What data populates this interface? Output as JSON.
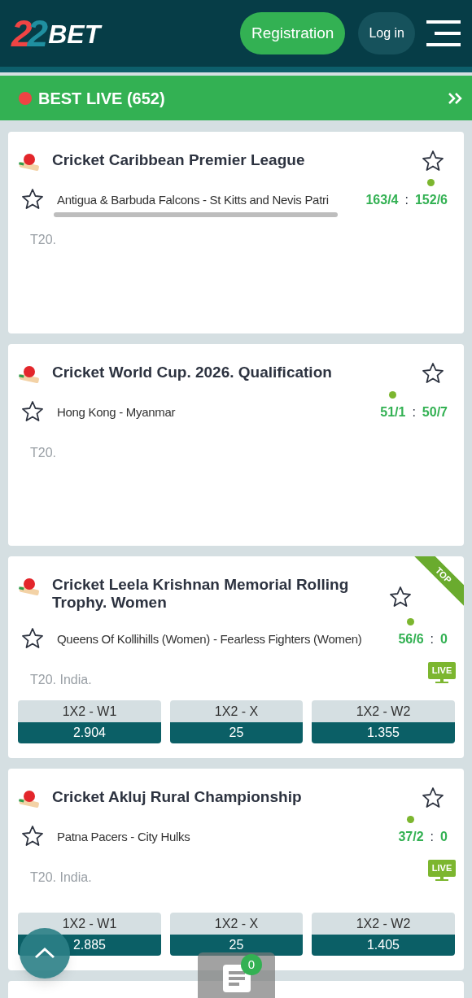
{
  "header": {
    "logo": {
      "digits": "22",
      "word": "BET"
    },
    "register_button": "Registration",
    "login_button": "Log in"
  },
  "live_bar": {
    "title": "BEST LIVE (652)"
  },
  "events": [
    {
      "league": "Cricket Caribbean Premier League",
      "teams": "Antigua & Barbuda Falcons - St Kitts and Nevis Patri",
      "scores": [
        {
          "value": "163/4",
          "batting": false
        },
        {
          "value": "152/6",
          "batting": true
        }
      ],
      "separator": ":",
      "info": "T20.",
      "live": false,
      "top": false,
      "scrolled": true
    },
    {
      "league": "Cricket World Cup. 2026. Qualification",
      "teams": "Hong Kong - Myanmar",
      "scores": [
        {
          "value": "51/1",
          "batting": true
        },
        {
          "value": "50/7",
          "batting": false
        }
      ],
      "separator": ":",
      "info": "T20.",
      "live": false,
      "top": false,
      "scrolled": false
    },
    {
      "league": "Cricket Leela Krishnan Memorial Rolling Trophy. Women",
      "teams": "Queens Of Kollihills (Women) - Fearless Fighters (Women)",
      "scores": [
        {
          "value": "56/6",
          "batting": true
        },
        {
          "value": "0",
          "batting": false
        }
      ],
      "separator": ":",
      "info": "T20. India.",
      "live": true,
      "live_label": "LIVE",
      "top": true,
      "top_label": "TOP",
      "scrolled": false,
      "odds": [
        {
          "label": "1X2 - W1",
          "value": "2.904"
        },
        {
          "label": "1X2 - X",
          "value": "25"
        },
        {
          "label": "1X2 - W2",
          "value": "1.355"
        }
      ]
    },
    {
      "league": "Cricket Akluj Rural Championship",
      "teams": "Patna Pacers - City Hulks",
      "scores": [
        {
          "value": "37/2",
          "batting": true
        },
        {
          "value": "0",
          "batting": false
        }
      ],
      "separator": ":",
      "info": "T20. India.",
      "live": true,
      "live_label": "LIVE",
      "top": false,
      "scrolled": false,
      "odds": [
        {
          "label": "1X2 - W1",
          "value": "2.885"
        },
        {
          "label": "1X2 - X",
          "value": "25"
        },
        {
          "label": "1X2 - W2",
          "value": "1.405"
        }
      ]
    }
  ],
  "bet_slip": {
    "count": "0"
  }
}
